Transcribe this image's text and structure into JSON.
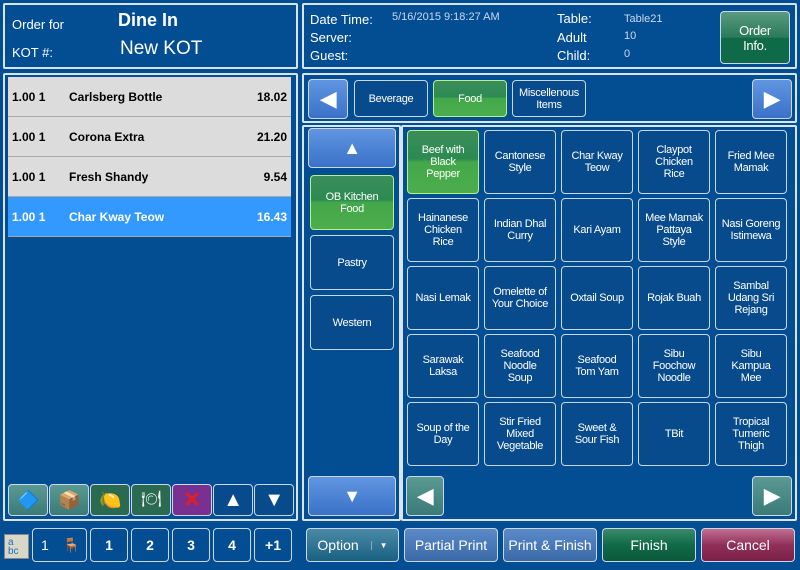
{
  "order": {
    "order_for_label": "Order for",
    "order_type": "Dine In",
    "kot_label": "KOT #:",
    "kot_value": "New KOT"
  },
  "info": {
    "datetime_label": "Date Time:",
    "datetime": "5/16/2015 9:18:27 AM",
    "server_label": "Server:",
    "guest_label": "Guest:",
    "table_label": "Table:",
    "table": "Table21",
    "adult_label": "Adult",
    "adult": "10",
    "child_label": "Child:",
    "child": "0",
    "order_info_button": "Order Info."
  },
  "categories": [
    {
      "label": "Beverage",
      "selected": false
    },
    {
      "label": "Food",
      "selected": true
    },
    {
      "label": "Miscellenous Items",
      "selected": false
    }
  ],
  "order_items": [
    {
      "qty": "1.00 1",
      "name": "Carlsberg Bottle",
      "price": "18.02",
      "selected": false
    },
    {
      "qty": "1.00 1",
      "name": "Corona Extra",
      "price": "21.20",
      "selected": false
    },
    {
      "qty": "1.00 1",
      "name": "Fresh Shandy",
      "price": "9.54",
      "selected": false
    },
    {
      "qty": "1.00 1",
      "name": "Char Kway Teow",
      "price": "16.43",
      "selected": true
    }
  ],
  "subcategories": [
    {
      "label": "OB Kitchen Food",
      "selected": true
    },
    {
      "label": "Pastry",
      "selected": false
    },
    {
      "label": "Western",
      "selected": false
    }
  ],
  "menu_items": [
    "Beef with Black Pepper",
    "Cantonese Style",
    "Char Kway Teow",
    "Claypot Chicken Rice",
    "Fried Mee Mamak",
    "Hainanese Chicken Rice",
    "Indian Dhal Curry",
    "Kari Ayam",
    "Mee Mamak Pattaya Style",
    "Nasi Goreng Istimewa",
    "Nasi Lemak",
    "Omelette of Your Choice",
    "Oxtail Soup",
    "Rojak Buah",
    "Sambal Udang Sri Rejang",
    "Sarawak Laksa",
    "Seafood Noodle Soup",
    "Seafood Tom Yam",
    "Sibu Foochow Noodle",
    "Sibu Kampua Mee",
    "Soup of the Day",
    "Stir Fried Mixed Vegetable",
    "Sweet & Sour Fish",
    "TBit",
    "Tropical Tumeric Thigh"
  ],
  "seat_buttons": {
    "seat": "1",
    "guests": [
      "1",
      "2",
      "3",
      "4",
      "+1"
    ]
  },
  "actions": {
    "option": "Option",
    "partial_print": "Partial Print",
    "print_finish": "Print & Finish",
    "finish": "Finish",
    "cancel": "Cancel"
  },
  "colors": {
    "background": "#034e93",
    "selected_row": "#3399ff",
    "selected_green": "#43a84a",
    "cancel": "#8a3050"
  }
}
